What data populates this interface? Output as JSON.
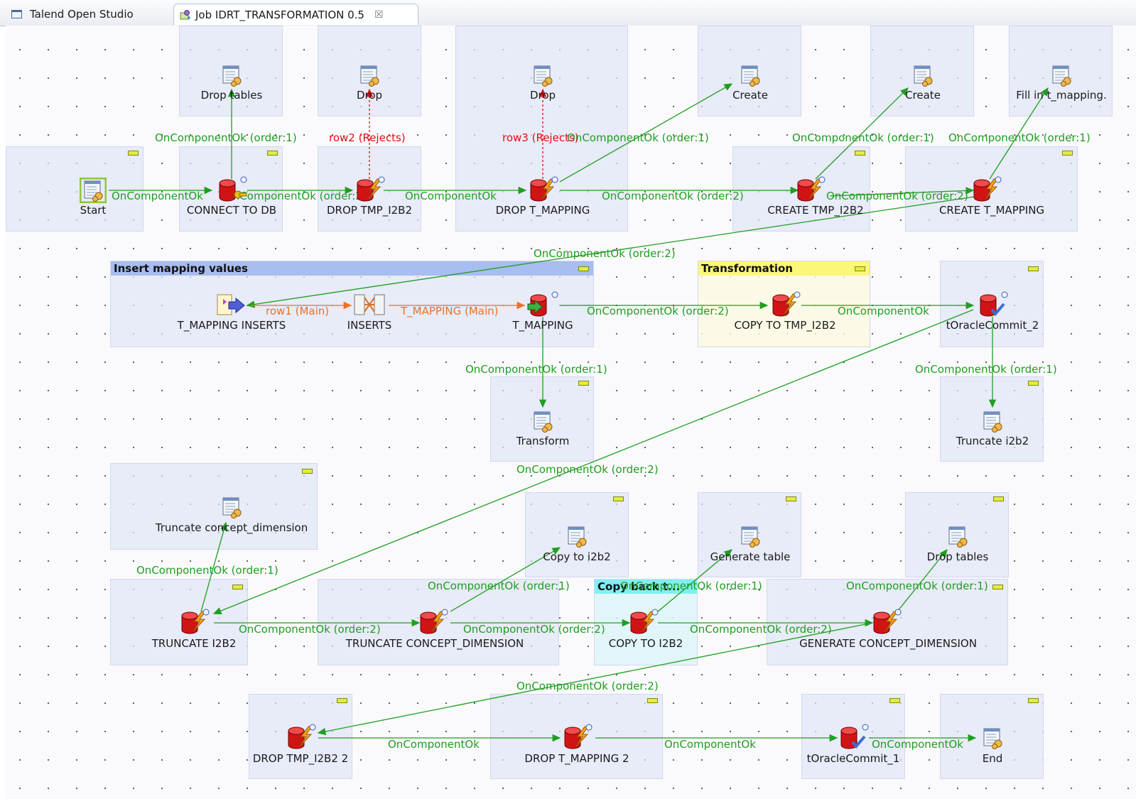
{
  "tabs": {
    "studio": "Talend Open Studio",
    "job": "Job IDRT_TRANSFORMATION 0.5"
  },
  "subjobs": {
    "insert_mapping_values": "Insert mapping values",
    "transformation": "Transformation",
    "copy_back": "Copy back t..."
  },
  "components": {
    "start": "Start",
    "drop_tables_1": "Drop tables",
    "connect_to_db": "CONNECT TO DB",
    "drop_1": "Drop",
    "drop_tmp_i2b2": "DROP TMP_I2B2",
    "drop_2": "Drop",
    "drop_t_mapping": "DROP T_MAPPING",
    "create_1": "Create",
    "create_tmp_i2b2": "CREATE TMP_I2B2",
    "create_2": "Create",
    "create_t_mapping": "CREATE T_MAPPING",
    "fill_in_mapping": "Fill in t_mapping.",
    "t_mapping_inserts": "T_MAPPING INSERTS",
    "inserts": "INSERTS",
    "t_mapping": "T_MAPPING",
    "copy_to_tmp_i2b2": "COPY TO TMP_I2B2",
    "toraclecommit_2": "tOracleCommit_2",
    "transform": "Transform",
    "truncate_i2b2_job": "Truncate i2b2",
    "truncate_concept_dimension_job": "Truncate concept_dimension",
    "copy_to_i2b2_job": "Copy to i2b2",
    "generate_table": "Generate table",
    "drop_tables_2": "Drop tables",
    "truncate_i2b2": "TRUNCATE  I2B2",
    "truncate_concept_dimension": "TRUNCATE  CONCEPT_DIMENSION",
    "copy_to_i2b2": "COPY TO I2B2",
    "generate_concept_dimension": "GENERATE CONCEPT_DIMENSION",
    "drop_tmp_i2b2_2": "DROP TMP_I2B2 2",
    "drop_t_mapping_2": "DROP T_MAPPING 2",
    "toraclecommit_1": "tOracleCommit_1",
    "end": "End"
  },
  "links": {
    "ok": "OnComponentOk",
    "ok_order1": "OnComponentOk (order:1)",
    "ok_order2": "OnComponentOk (order:2)",
    "row2_rejects": "row2 (Rejects)",
    "row3_rejects": "row3 (Rejects)",
    "row1_main": "row1 (Main)",
    "t_mapping_main": "T_MAPPING (Main)"
  },
  "colors": {
    "trigger_link": "#1f9e1f",
    "reject_link": "#e01010",
    "main_link": "#f07020",
    "db_component": "#d01414",
    "subjob_insert_header": "#a8bdf0",
    "subjob_transformation_header": "#fbf77a",
    "subjob_copyback_header": "#7ff0f2"
  }
}
